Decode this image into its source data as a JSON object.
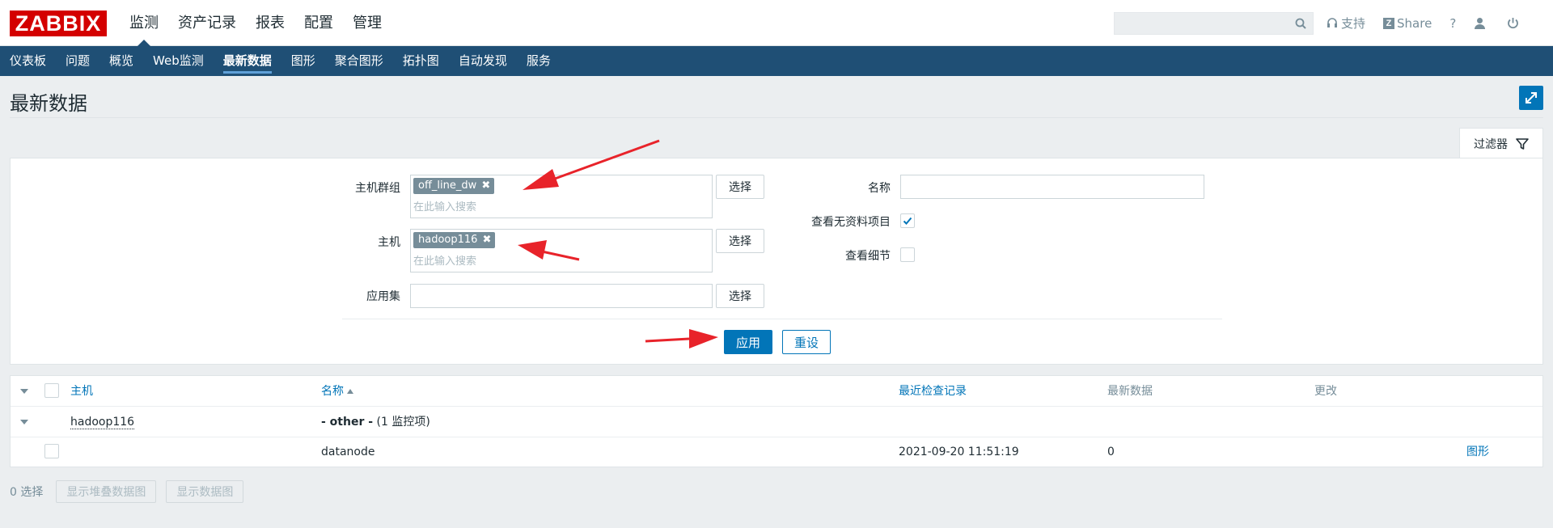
{
  "logo": "ZABBIX",
  "main_nav": [
    "监测",
    "资产记录",
    "报表",
    "配置",
    "管理"
  ],
  "search": {
    "value": "",
    "placeholder": ""
  },
  "header_tools": {
    "support": "支持",
    "share": "Share",
    "help": "?"
  },
  "sub_nav": [
    "仪表板",
    "问题",
    "概览",
    "Web监测",
    "最新数据",
    "图形",
    "聚合图形",
    "拓扑图",
    "自动发现",
    "服务"
  ],
  "page_title": "最新数据",
  "filter": {
    "tab_label": "过滤器",
    "host_group_label": "主机群组",
    "host_group_tag": "off_line_dw",
    "host_label": "主机",
    "host_tag": "hadoop116",
    "application_label": "应用集",
    "search_placeholder": "在此输入搜索",
    "select_label": "选择",
    "name_label": "名称",
    "name_value": "",
    "show_without_data_label": "查看无资料项目",
    "show_without_data_checked": true,
    "show_details_label": "查看细节",
    "show_details_checked": false,
    "apply_label": "应用",
    "reset_label": "重设"
  },
  "table": {
    "headers": {
      "host": "主机",
      "name": "名称",
      "last_check": "最近检查记录",
      "last_value": "最新数据",
      "change": "更改"
    },
    "group_host": "hadoop116",
    "group_app": "- other -",
    "group_count": "(1 监控项)",
    "item": {
      "name": "datanode",
      "last_check": "2021-09-20 11:51:19",
      "last_value": "0",
      "graph": "图形"
    }
  },
  "footer": {
    "selected": "0 选择",
    "stacked_graph": "显示堆叠数据图",
    "graph": "显示数据图"
  },
  "colors": {
    "brand": "#d40000",
    "nav": "#1f4f75",
    "accent": "#0275b8",
    "annotation": "#e8232a"
  }
}
